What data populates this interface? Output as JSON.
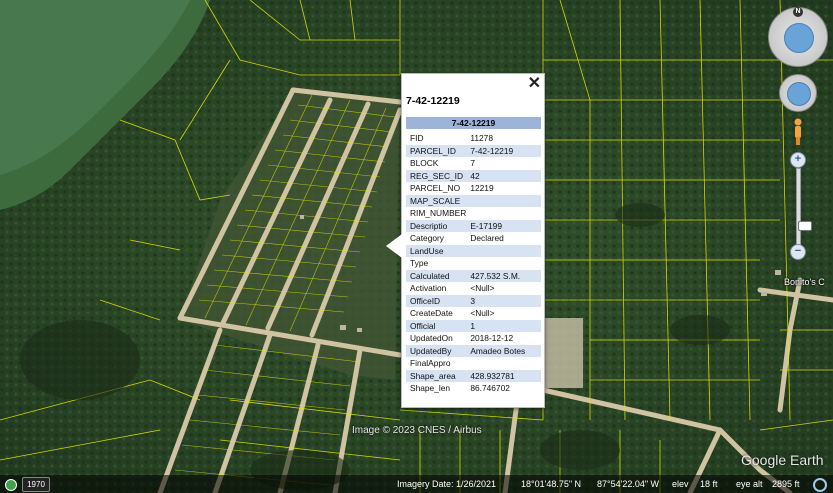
{
  "popup": {
    "title": "7-42-12219",
    "header": "7-42-12219",
    "close_label": "✕",
    "rows": [
      {
        "k": "FID",
        "v": "11278"
      },
      {
        "k": "PARCEL_ID",
        "v": "7-42-12219"
      },
      {
        "k": "BLOCK",
        "v": "7"
      },
      {
        "k": "REG_SEC_ID",
        "v": "42"
      },
      {
        "k": "PARCEL_NO",
        "v": "12219"
      },
      {
        "k": "MAP_SCALE",
        "v": ""
      },
      {
        "k": "RIM_NUMBER",
        "v": ""
      },
      {
        "k": "Descriptio",
        "v": "E-17199"
      },
      {
        "k": "Category",
        "v": "Declared"
      },
      {
        "k": "LandUse",
        "v": ""
      },
      {
        "k": "Type",
        "v": ""
      },
      {
        "k": "Calculated",
        "v": "427.532 S.M."
      },
      {
        "k": "Activation",
        "v": "<Null>"
      },
      {
        "k": "OfficeID",
        "v": "3"
      },
      {
        "k": "CreateDate",
        "v": "<Null>"
      },
      {
        "k": "Official",
        "v": "1"
      },
      {
        "k": "UpdatedOn",
        "v": "2018-12-12"
      },
      {
        "k": "UpdatedBy",
        "v": "Amadeo Botes"
      },
      {
        "k": "FinalAppro",
        "v": ""
      },
      {
        "k": "Shape_area",
        "v": "428.932781"
      },
      {
        "k": "Shape_len",
        "v": "86.746702"
      }
    ]
  },
  "map": {
    "attribution": "Image © 2023 CNES / Airbus",
    "logo": "Google Earth",
    "place_label": "Bonito's C",
    "compass_label": "N"
  },
  "status_bar": {
    "historical_year": "1970",
    "imagery_date": "Imagery Date: 1/26/2021",
    "latitude": "18°01'48.75\" N",
    "longitude": "87°54'22.04\" W",
    "elev_label": "elev",
    "elev_value": "18 ft",
    "eye_alt_label": "eye alt",
    "eye_alt_value": "2895 ft"
  },
  "icons": {
    "clock": "clock-icon",
    "spinner": "loading-icon",
    "pegman": "pegman-icon"
  },
  "colors": {
    "parcel_lines": "#e8e800",
    "popup_header": "#9cb4d8",
    "popup_stripe": "#d7e2f2"
  }
}
